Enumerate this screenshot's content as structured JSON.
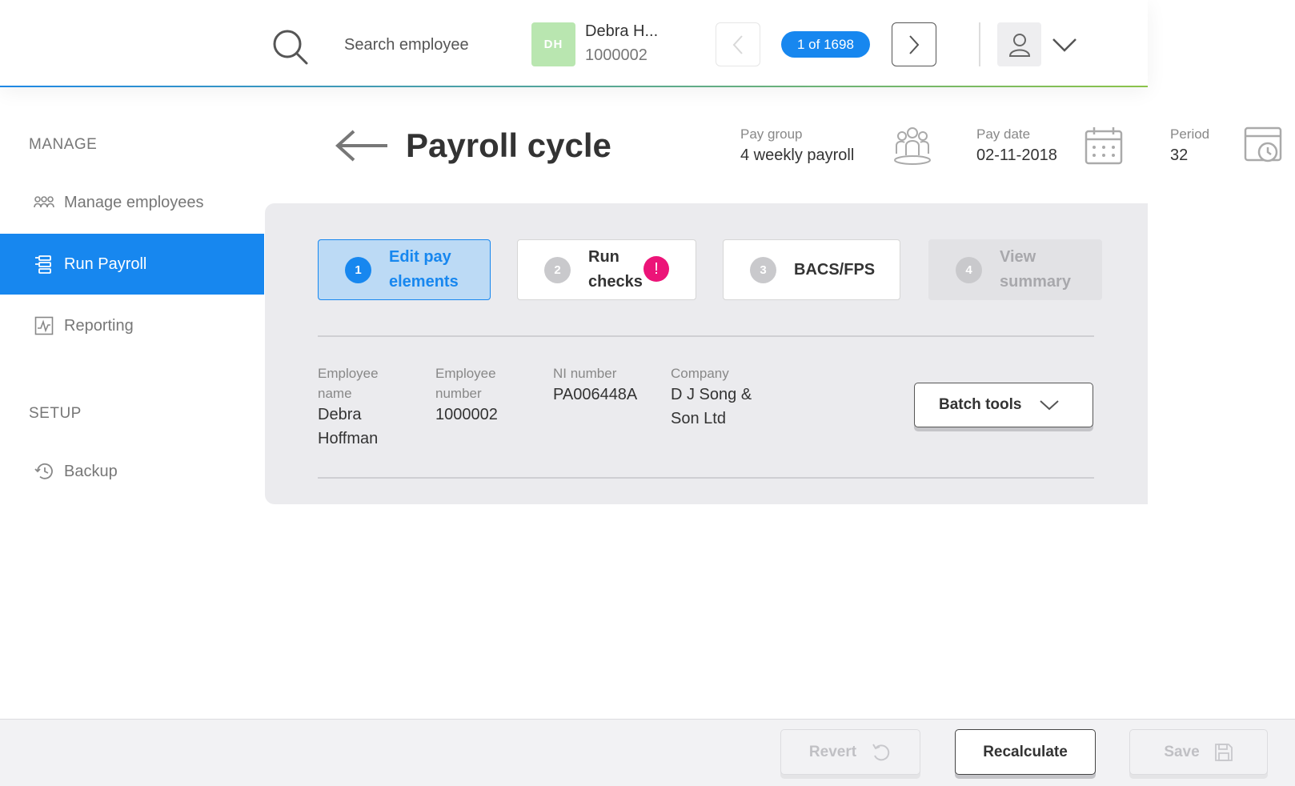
{
  "topbar": {
    "search_placeholder": "Search employee",
    "employee": {
      "initials": "DH",
      "name": "Debra H...",
      "number": "1000002"
    },
    "counter": "1 of 1698"
  },
  "sidebar": {
    "manage_heading": "MANAGE",
    "setup_heading": "SETUP",
    "items": [
      {
        "label": "Manage employees",
        "icon": "people-icon"
      },
      {
        "label": "Run Payroll",
        "icon": "payroll-icon",
        "active": true
      },
      {
        "label": "Reporting",
        "icon": "chart-icon"
      },
      {
        "label": "Backup",
        "icon": "history-icon"
      }
    ]
  },
  "header": {
    "title": "Payroll cycle",
    "pay_group_label": "Pay group",
    "pay_group_value": "4 weekly payroll",
    "pay_date_label": "Pay date",
    "pay_date_value": "02-11-2018",
    "period_label": "Period",
    "period_value": "32"
  },
  "steps": [
    {
      "num": "1",
      "line1": "Edit pay",
      "line2": "elements",
      "state": "current"
    },
    {
      "num": "2",
      "line1": "Run",
      "line2": "checks",
      "state": "alert",
      "alert": "!"
    },
    {
      "num": "3",
      "line1": "BACS/FPS",
      "line2": "",
      "state": "normal"
    },
    {
      "num": "4",
      "line1": "View",
      "line2": "summary",
      "state": "disabled"
    }
  ],
  "employee_details": {
    "name_label_1": "Employee",
    "name_label_2": "name",
    "name_value_1": "Debra",
    "name_value_2": "Hoffman",
    "number_label_1": "Employee",
    "number_label_2": "number",
    "number_value": "1000002",
    "ni_label": "NI number",
    "ni_value": "PA006448A",
    "company_label": "Company",
    "company_value_1": "D J Song &",
    "company_value_2": "Son Ltd"
  },
  "batch_tools_label": "Batch tools",
  "footer": {
    "revert_label": "Revert",
    "recalculate_label": "Recalculate",
    "save_label": "Save"
  },
  "colors": {
    "accent": "#1787ef",
    "alert": "#ec1478",
    "avatar": "#b9e6b0"
  }
}
